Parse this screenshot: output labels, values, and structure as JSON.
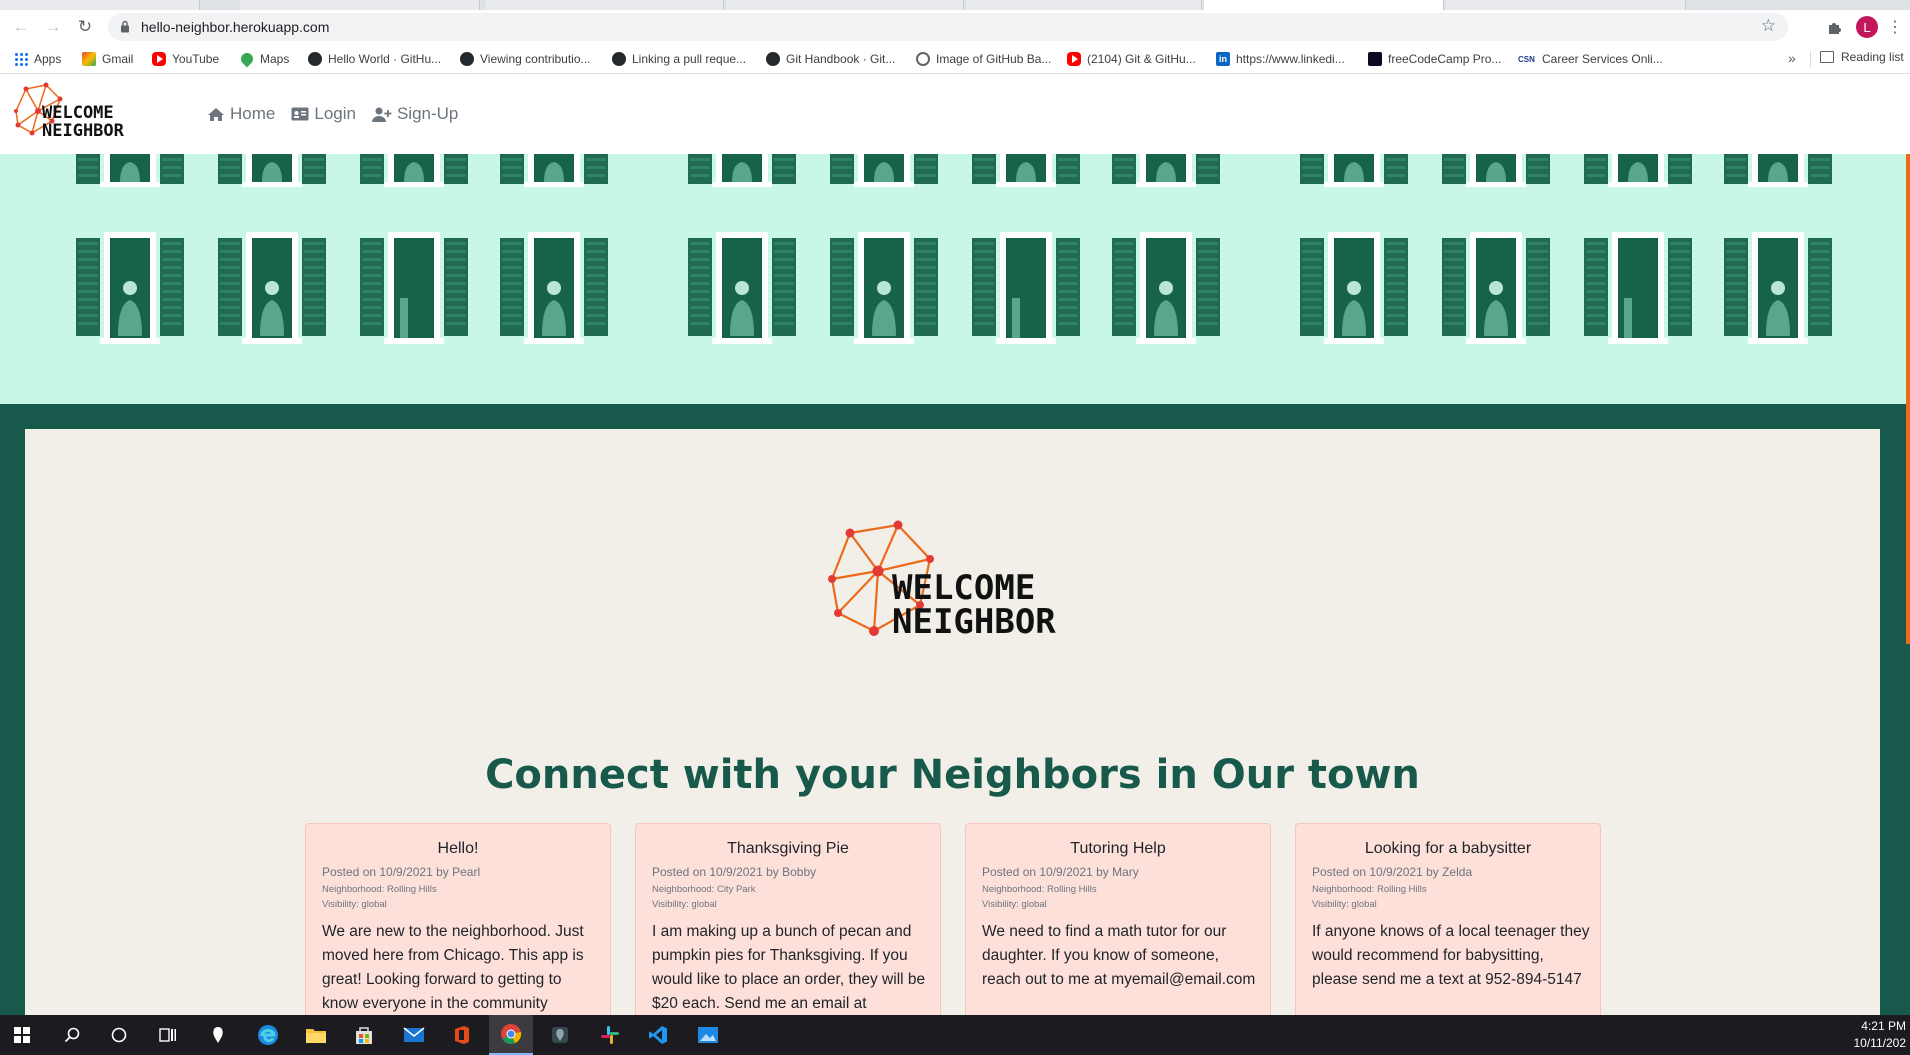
{
  "browser": {
    "url": "hello-neighbor.herokuapp.com",
    "avatar_letter": "L",
    "bookmarks": [
      {
        "label": "Apps",
        "icon": "apps-grid-icon"
      },
      {
        "label": "Gmail",
        "icon": "gmail-icon"
      },
      {
        "label": "YouTube",
        "icon": "youtube-icon"
      },
      {
        "label": "Maps",
        "icon": "maps-icon"
      },
      {
        "label": "Hello World · GitHu...",
        "icon": "github-icon"
      },
      {
        "label": "Viewing contributio...",
        "icon": "github-icon"
      },
      {
        "label": "Linking a pull reque...",
        "icon": "github-icon"
      },
      {
        "label": "Git Handbook · Git...",
        "icon": "github-icon"
      },
      {
        "label": "Image of GitHub Ba...",
        "icon": "globe-icon"
      },
      {
        "label": "(2104) Git & GitHu...",
        "icon": "youtube-icon"
      },
      {
        "label": "https://www.linkedi...",
        "icon": "linkedin-icon"
      },
      {
        "label": "freeCodeCamp Pro...",
        "icon": "freecodecamp-icon"
      },
      {
        "label": "Career Services Onli...",
        "icon": "csn-icon"
      }
    ],
    "more_label": "»",
    "reading_list": "Reading list"
  },
  "site": {
    "logo_line1": "WELCOME",
    "logo_line2": "NEIGHBOR",
    "nav": [
      {
        "label": "Home",
        "icon": "home-icon"
      },
      {
        "label": "Login",
        "icon": "id-card-icon"
      },
      {
        "label": "Sign-Up",
        "icon": "user-plus-icon"
      }
    ],
    "heading": "Connect with your Neighbors in Our town",
    "posts": [
      {
        "title": "Hello!",
        "posted": "Posted on 10/9/2021 by Pearl",
        "neighborhood": "Neighborhood: Rolling Hills",
        "visibility": "Visibility: global",
        "body": "We are new to the neighborhood. Just moved here from Chicago. This app is great! Looking forward to getting to know everyone in the community"
      },
      {
        "title": "Thanksgiving Pie",
        "posted": "Posted on 10/9/2021 by Bobby",
        "neighborhood": "Neighborhood: City Park",
        "visibility": "Visibility: global",
        "body": "I am making up a bunch of pecan and pumpkin pies for Thanksgiving. If you would like to place an order, they will be $20 each. Send me an email at"
      },
      {
        "title": "Tutoring Help",
        "posted": "Posted on 10/9/2021 by Mary",
        "neighborhood": "Neighborhood: Rolling Hills",
        "visibility": "Visibility: global",
        "body": "We need to find a math tutor for our daughter. If you know of someone, reach out to me at myemail@email.com"
      },
      {
        "title": "Looking for a babysitter",
        "posted": "Posted on 10/9/2021 by Zelda",
        "neighborhood": "Neighborhood: Rolling Hills",
        "visibility": "Visibility: global",
        "body": "If anyone knows of a local teenager they would recommend for babysitting, please send me a text at 952-894-5147"
      }
    ]
  },
  "taskbar": {
    "time": "4:21 PM",
    "date": "10/11/202"
  },
  "colors": {
    "brand_dark_green": "#17594a",
    "hero_mint": "#c8f7e5",
    "card_pink": "#fde0da",
    "panel_beige": "#f2efe9",
    "logo_orange": "#ed6a1a",
    "logo_red": "#e53935"
  }
}
